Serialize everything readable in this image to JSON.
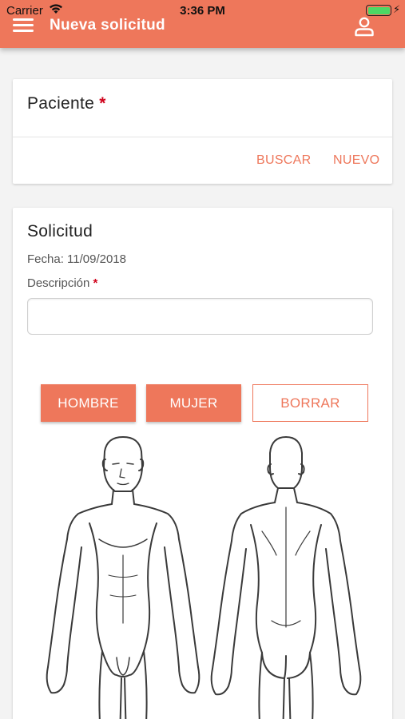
{
  "status_bar": {
    "carrier": "Carrier",
    "time": "3:36 PM"
  },
  "header": {
    "title": "Nueva solicitud",
    "menu_icon": "hamburger-menu-icon",
    "user_icon": "user-profile-icon"
  },
  "paciente": {
    "title": "Paciente",
    "required_mark": "*",
    "buscar_label": "BUSCAR",
    "nuevo_label": "NUEVO"
  },
  "solicitud": {
    "title": "Solicitud",
    "fecha": "Fecha: 11/09/2018",
    "descripcion_label": "Descripción",
    "required_mark": "*",
    "descripcion_value": "",
    "buttons": {
      "hombre": "HOMBRE",
      "mujer": "MUJER",
      "borrar": "BORRAR"
    },
    "body_figure": "male-body-front-back"
  },
  "colors": {
    "accent": "#ee775b",
    "required": "#d0021b",
    "background": "#f3f3f3"
  }
}
